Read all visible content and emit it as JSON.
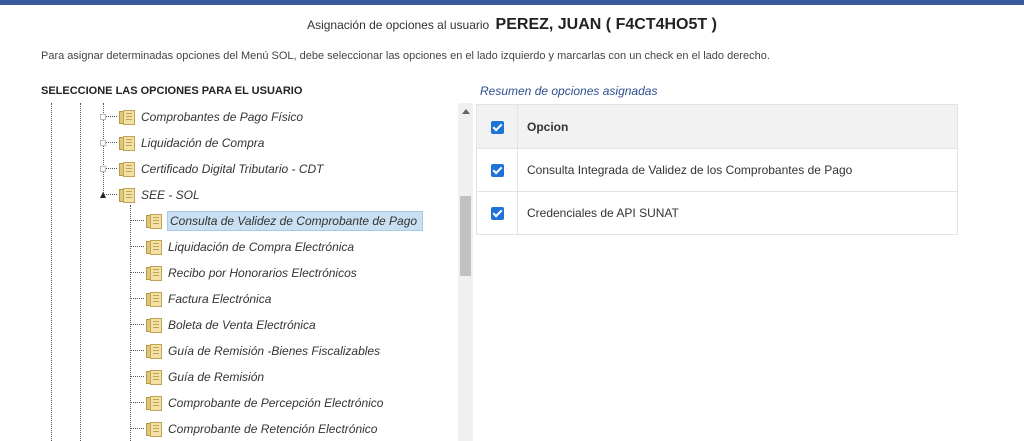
{
  "header": {
    "title_prefix": "Asignación de opciones al usuario",
    "user_name": "PEREZ, JUAN ( F4CT4HO5T )"
  },
  "instructions": "Para asignar determinadas opciones del Menú SOL, debe seleccionar las opciones en el lado izquierdo y marcarlas con un check en el lado derecho.",
  "tree": {
    "heading": "SELECCIONE LAS OPCIONES PARA EL USUARIO",
    "parents": [
      {
        "label": "Comprobantes de Pago Físico",
        "expanded": false
      },
      {
        "label": "Liquidación de Compra",
        "expanded": false
      },
      {
        "label": "Certificado Digital Tributario - CDT",
        "expanded": false
      },
      {
        "label": "SEE - SOL",
        "expanded": true
      }
    ],
    "children": [
      {
        "label": "Consulta de Validez de Comprobante de Pago",
        "selected": true
      },
      {
        "label": "Liquidación de Compra Electrónica",
        "selected": false
      },
      {
        "label": "Recibo por Honorarios Electrónicos",
        "selected": false
      },
      {
        "label": "Factura Electrónica",
        "selected": false
      },
      {
        "label": "Boleta de Venta Electrónica",
        "selected": false
      },
      {
        "label": "Guía de Remisión -Bienes Fiscalizables",
        "selected": false
      },
      {
        "label": "Guía de Remisión",
        "selected": false
      },
      {
        "label": "Comprobante de Percepción Electrónico",
        "selected": false
      },
      {
        "label": "Comprobante de Retención Electrónico",
        "selected": false
      }
    ]
  },
  "summary": {
    "title": "Resumen de opciones asignadas",
    "header_label": "Opcion",
    "header_checked": true,
    "rows": [
      {
        "label": "Consulta Integrada de Validez de los Comprobantes de Pago",
        "checked": true
      },
      {
        "label": "Credenciales de API SUNAT",
        "checked": true
      }
    ]
  },
  "colors": {
    "top_bar": "#3a5b9b",
    "checkbox": "#1e74d6",
    "selection": "#c8e0f2",
    "summary_title": "#2d4f8e"
  }
}
